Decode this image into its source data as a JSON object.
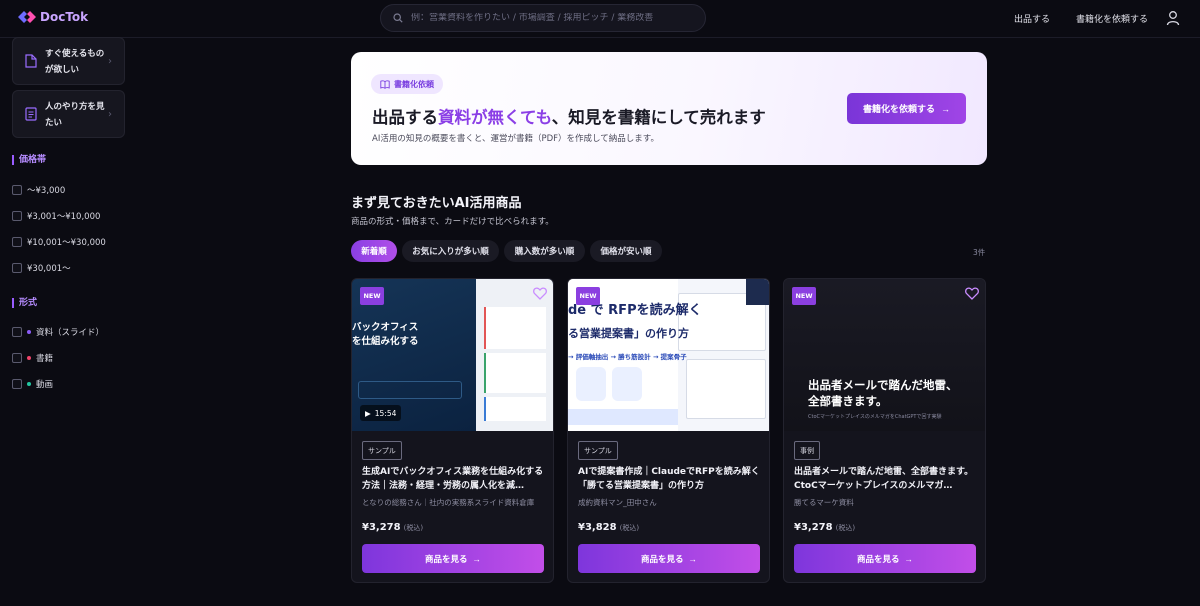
{
  "header": {
    "logo_text": "DocTok",
    "search_placeholder": "例：営業資料を作りたい / 市場調査 / 採用ピッチ / 業務改善",
    "nav_sell": "出品する",
    "nav_request": "書籍化を依頼する"
  },
  "sidebar": {
    "cards": [
      {
        "label": "すぐ使えるものが欲しい"
      },
      {
        "label": "人のやり方を見たい"
      }
    ],
    "price_title": "価格帯",
    "price_options": [
      "〜¥3,000",
      "¥3,001〜¥10,000",
      "¥10,001〜¥30,000",
      "¥30,001〜"
    ],
    "format_title": "形式",
    "format_options": [
      {
        "label": "資料（スライド）",
        "color": "#8b5cf6"
      },
      {
        "label": "書籍",
        "color": "#ef4469"
      },
      {
        "label": "動画",
        "color": "#22c5a0"
      }
    ]
  },
  "hero": {
    "badge": "書籍化依頼",
    "title_pre": "出品する",
    "title_accent": "資料が無くても",
    "title_post": "、知見を書籍にして売れます",
    "subtitle": "AI活用の知見の概要を書くと、運営が書籍（PDF）を作成して納品します。",
    "button": "書籍化を依頼する"
  },
  "section": {
    "title": "まず見ておきたいAI活用商品",
    "subtitle": "商品の形式・価格まで、カードだけで比べられます。",
    "sorts": [
      "新着順",
      "お気に入りが多い順",
      "購入数が多い順",
      "価格が安い順"
    ],
    "count": "3件"
  },
  "products": [
    {
      "badge": "NEW",
      "tag": "サンプル",
      "title": "生成AIでバックオフィス業務を仕組み化する方法｜法務・経理・労務の属人化を減…",
      "seller": "となりの総務さん｜社内の実務系スライド資料倉庫",
      "price": "¥3,278",
      "tax": "(税込)",
      "button": "商品を見る",
      "duration": "15:54",
      "thumb_line1": "バックオフィス",
      "thumb_line2": "を仕組み化する"
    },
    {
      "badge": "NEW",
      "tag": "サンプル",
      "title": "AIで提案書作成｜ClaudeでRFPを読み解く「勝てる営業提案書」の作り方",
      "seller": "成約資料マン_田中さん",
      "price": "¥3,828",
      "tax": "(税込)",
      "button": "商品を見る",
      "thumb_line1": "de で RFPを読み解く",
      "thumb_line2": "る営業提案書」の作り方",
      "thumb_line3": "→ 評価軸抽出 → 勝ち筋設計 → 提案骨子"
    },
    {
      "badge": "NEW",
      "tag": "事例",
      "title": "出品者メールで踏んだ地雷、全部書きます。CtoCマーケットプレイスのメルマガ…",
      "seller": "勝てるマーケ資料",
      "price": "¥3,278",
      "tax": "(税込)",
      "button": "商品を見る",
      "thumb_line1": "出品者メールで踏んだ地雷、",
      "thumb_line2": "全部書きます。",
      "thumb_small": "CtoCマーケットプレイスのメルマガをChatGPTで回す実験"
    }
  ]
}
